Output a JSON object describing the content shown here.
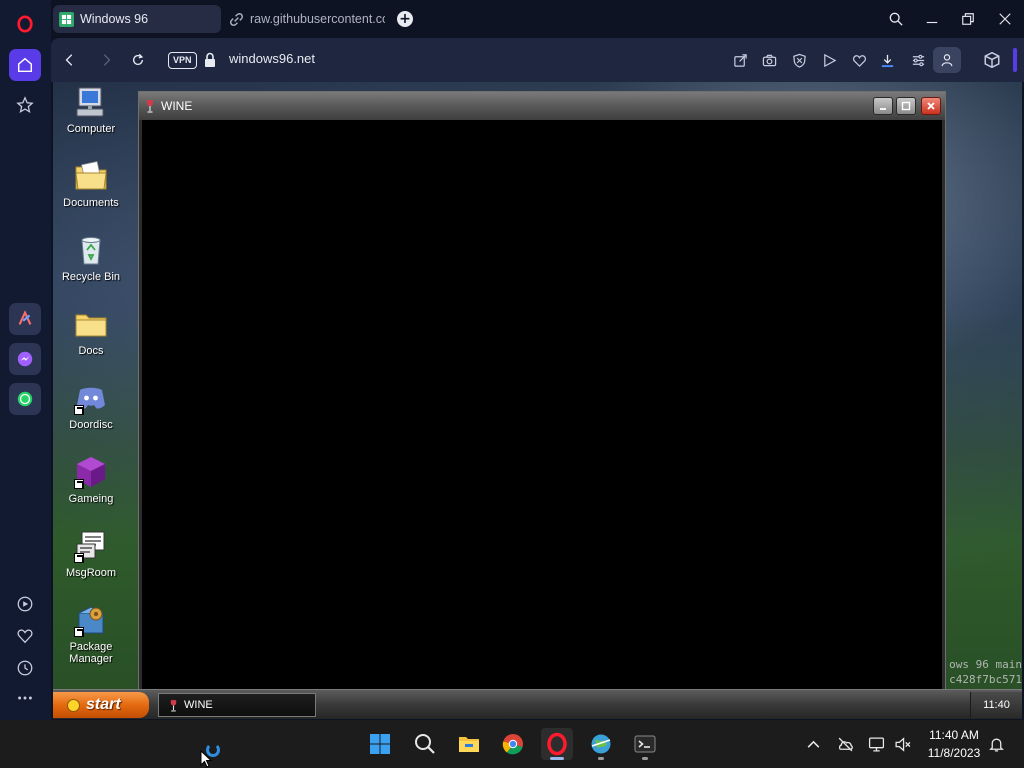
{
  "browser": {
    "tabs": [
      {
        "title": "Windows 96",
        "icon": "windows96-favicon-icon",
        "active": true
      },
      {
        "title": "raw.githubusercontent.com",
        "icon": "link-icon",
        "active": false
      }
    ],
    "vpn_label": "VPN",
    "url": "windows96.net",
    "accent_color": "#5a3be8"
  },
  "desktop": {
    "icons": [
      {
        "label": "Computer",
        "icon": "computer-icon"
      },
      {
        "label": "Documents",
        "icon": "documents-folder-icon"
      },
      {
        "label": "Recycle Bin",
        "icon": "recycle-bin-icon"
      },
      {
        "label": "Docs",
        "icon": "folder-icon"
      },
      {
        "label": "Doordisc",
        "icon": "discord-icon"
      },
      {
        "label": "Gameing",
        "icon": "purple-cube-icon"
      },
      {
        "label": "MsgRoom",
        "icon": "msgroom-icon"
      },
      {
        "label": "Package Manager",
        "icon": "package-manager-icon"
      }
    ],
    "bg_text_line1": "ows 96 main",
    "bg_text_line2": "c428f7bc571"
  },
  "wine_window": {
    "title": "WINE"
  },
  "w96_taskbar": {
    "start_label": "start",
    "task_item": "WINE",
    "clock": "11:40"
  },
  "windows_taskbar": {
    "time": "11:40 AM",
    "date": "11/8/2023",
    "apps": [
      "start-windows-icon",
      "search-icon",
      "file-explorer-icon",
      "chrome-icon",
      "opera-icon",
      "world-app-icon",
      "terminal-icon"
    ]
  }
}
